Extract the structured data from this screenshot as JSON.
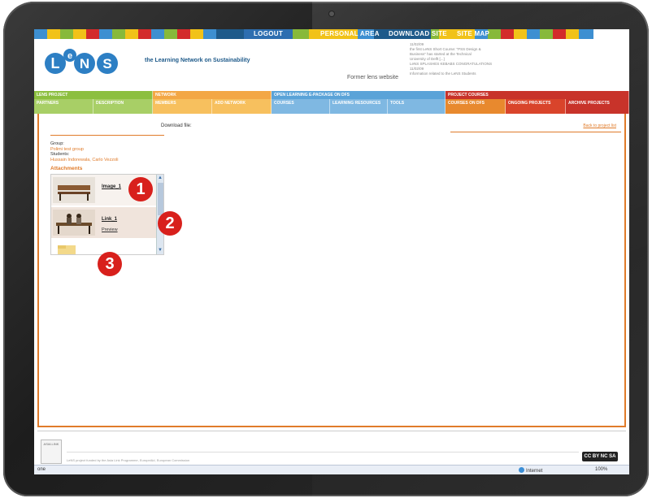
{
  "top_nav": {
    "logout": "LOGOUT",
    "personal_area": "PERSONAL AREA",
    "download_site": "DOWNLOAD SITE",
    "site_map": "SITE MAP"
  },
  "header": {
    "logo_text": "LeNS",
    "tagline": "the Learning Network on Sustainability",
    "former_link": "Former lens website",
    "news": [
      "11/02/09",
      "the first LeNS Short Course: \"PSS Design &",
      "Business\" has started at the Technical",
      "University of Delft [...]",
      "LeNS SPLASHES KEBABS CONGRATULATIONS",
      "11/02/09",
      "Information related to the LeNS Students"
    ]
  },
  "nav": {
    "top": [
      "LENS PROJECT",
      "NETWORK",
      "OPEN LEARNING E-PACKAGE ON DFS",
      "PROJECT COURSES"
    ],
    "sub": [
      "PARTNERS",
      "DESCRIPTION",
      "MEMBERS",
      "ADD NETWORK",
      "COURSES",
      "LEARNING RESOURCES",
      "TOOLS",
      "COURSES ON DFS",
      "ONGOING PROJECTS",
      "ARCHIVE PROJECTS"
    ]
  },
  "content": {
    "download_label": "Download file:",
    "back_link": "Back to project list",
    "group_key": "Group:",
    "group_value": "Polimi test group",
    "students_key": "Students:",
    "students_value": "Hussain Indorewala, Carlo Vezzoli",
    "attachments_heading": "Attachments",
    "attachments": [
      {
        "label": "Image_1",
        "sub": ""
      },
      {
        "label": "Link_1",
        "sub": "Preview"
      },
      {
        "label": "",
        "sub": ""
      }
    ]
  },
  "callouts": [
    "1",
    "2",
    "3"
  ],
  "footer": {
    "eu_text": "ASIA LINK",
    "funding": "LeNS project funded by the Asia Link Programme, EuropeAid, European Commission",
    "cc": "CC BY NC SA"
  },
  "statusbar": {
    "left": "one",
    "zone": "Internet",
    "zoom": "100%"
  },
  "colors": {
    "orange": "#e07b2a",
    "red_callout": "#d8201c",
    "lens_blue": "#1e5a8a"
  }
}
